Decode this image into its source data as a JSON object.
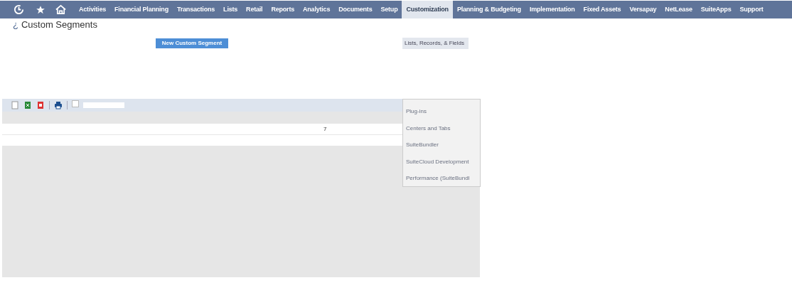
{
  "nav": {
    "items": [
      {
        "label": "Activities",
        "selected": false
      },
      {
        "label": "Financial Planning",
        "selected": false
      },
      {
        "label": "Transactions",
        "selected": false
      },
      {
        "label": "Lists",
        "selected": false
      },
      {
        "label": "Retail",
        "selected": false
      },
      {
        "label": "Reports",
        "selected": false
      },
      {
        "label": "Analytics",
        "selected": false
      },
      {
        "label": "Documents",
        "selected": false
      },
      {
        "label": "Setup",
        "selected": false
      },
      {
        "label": "Customization",
        "selected": true
      },
      {
        "label": "Planning & Budgeting",
        "selected": false
      },
      {
        "label": "Implementation",
        "selected": false
      },
      {
        "label": "Fixed Assets",
        "selected": false
      },
      {
        "label": "Versapay",
        "selected": false
      },
      {
        "label": "NetLease",
        "selected": false
      },
      {
        "label": "SuiteApps",
        "selected": false
      },
      {
        "label": "Support",
        "selected": false
      }
    ]
  },
  "page": {
    "help_mark": "¿",
    "title": "Custom Segments",
    "new_button": "New Custom Segment"
  },
  "menu": {
    "items": [
      {
        "label": "Lists, Records, & Fields",
        "selected": true
      },
      {
        "label": "Plug-ins",
        "selected": false
      },
      {
        "label": "Centers and Tabs",
        "selected": false
      },
      {
        "label": "SuiteBundler",
        "selected": false
      },
      {
        "label": "SuiteCloud Development",
        "selected": false
      },
      {
        "label": "Performance (SuiteBundl",
        "selected": false
      }
    ]
  },
  "toolbar": {
    "checkbox": {
      "checked": false
    }
  },
  "table": {
    "rows": [
      {
        "column_2": "7"
      },
      {}
    ]
  }
}
